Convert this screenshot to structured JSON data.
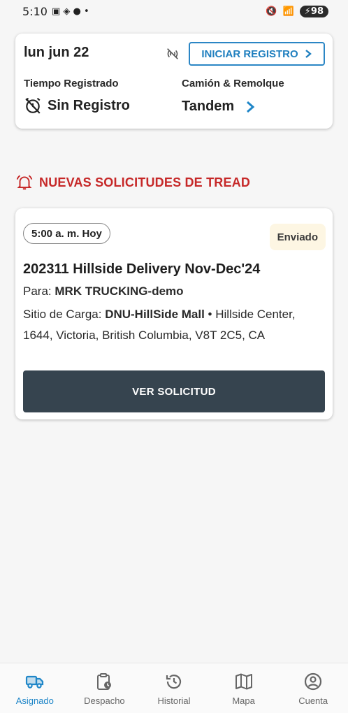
{
  "status_bar": {
    "time": "5:10",
    "battery": "98"
  },
  "assignment": {
    "date": "lun jun 22",
    "start_button": "INICIAR REGISTRO",
    "time_label": "Tiempo Registrado",
    "time_value": "Sin Registro",
    "truck_label": "Camión & Remolque",
    "truck_value": "Tandem"
  },
  "section": {
    "title": "NUEVAS SOLICITUDES DE TREAD"
  },
  "request": {
    "time": "5:00 a. m. Hoy",
    "status": "Enviado",
    "title": "202311 Hillside Delivery Nov-Dec'24",
    "to_label": "Para:",
    "to_value": "MRK TRUCKING-demo",
    "site_label": "Sitio de Carga:",
    "site_name": "DNU-HillSide Mall",
    "site_address": "Hillside Center, 1644, Victoria, British Columbia, V8T 2C5, CA",
    "view_button": "VER SOLICITUD"
  },
  "nav": [
    {
      "label": "Asignado",
      "icon": "truck-icon",
      "active": true
    },
    {
      "label": "Despacho",
      "icon": "clipboard-clock-icon",
      "active": false
    },
    {
      "label": "Historial",
      "icon": "history-icon",
      "active": false
    },
    {
      "label": "Mapa",
      "icon": "map-icon",
      "active": false
    },
    {
      "label": "Cuenta",
      "icon": "account-icon",
      "active": false
    }
  ],
  "colors": {
    "accent": "#1f86c8",
    "alert": "#c62828",
    "button_dark": "#36444f"
  }
}
